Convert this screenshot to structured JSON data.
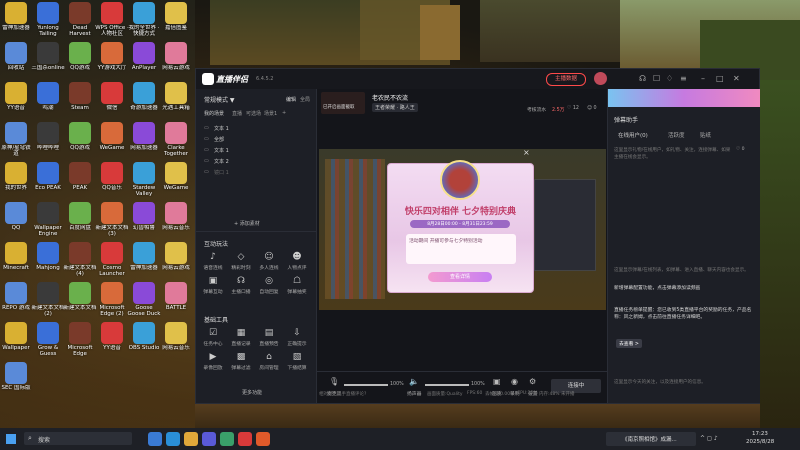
{
  "desktop": {
    "icons": [
      {
        "label": "雷神加速器"
      },
      {
        "label": "Yunlong Tailing"
      },
      {
        "label": "Dead Harvest"
      },
      {
        "label": "WPS Office · 人物社区"
      },
      {
        "label": "我的全世界 · 快捷方式"
      },
      {
        "label": "嘉倍图鉴"
      },
      {
        "label": "回收站"
      },
      {
        "label": "三国杀online"
      },
      {
        "label": "QQ游戏"
      },
      {
        "label": "YY游戏大厅"
      },
      {
        "label": "AnPlayer"
      },
      {
        "label": "网易云游戏"
      },
      {
        "label": "YY语音"
      },
      {
        "label": "鸣潮"
      },
      {
        "label": "Steam"
      },
      {
        "label": "微信"
      },
      {
        "label": "奇游加速器"
      },
      {
        "label": "光遇工具箱"
      },
      {
        "label": "原神/星穹铁道"
      },
      {
        "label": "哔哩哔哩"
      },
      {
        "label": "QQ游戏"
      },
      {
        "label": "WeGame"
      },
      {
        "label": "网易加速器"
      },
      {
        "label": "Clarke Together"
      },
      {
        "label": "我的世界"
      },
      {
        "label": "Eco PEAK"
      },
      {
        "label": "PEAK"
      },
      {
        "label": "QQ音乐"
      },
      {
        "label": "Stardew Valley"
      },
      {
        "label": "WeGame"
      },
      {
        "label": "QQ"
      },
      {
        "label": "Wallpaper Engine"
      },
      {
        "label": "百度网盘"
      },
      {
        "label": "新建文本文档 (3)"
      },
      {
        "label": "幻兽帕鲁"
      },
      {
        "label": "网易云音乐"
      },
      {
        "label": "Minecraft"
      },
      {
        "label": "Mahjong"
      },
      {
        "label": "新建文本文档 (4)"
      },
      {
        "label": "Cosmo Launcher"
      },
      {
        "label": "雷神加速器"
      },
      {
        "label": "网易云游戏"
      },
      {
        "label": "REPO 游戏"
      },
      {
        "label": "新建文本文档 (2)"
      },
      {
        "label": "新建文本文档"
      },
      {
        "label": "Microsoft Edge (2)"
      },
      {
        "label": "Goose Goose Duck"
      },
      {
        "label": "BATTLE"
      },
      {
        "label": "Wallpaper"
      },
      {
        "label": "Grow & Guess"
      },
      {
        "label": "Microsoft Edge"
      },
      {
        "label": "YY语音"
      },
      {
        "label": "OBS Studio"
      },
      {
        "label": "网易云音乐"
      },
      {
        "label": "SEC 国际版"
      }
    ]
  },
  "app": {
    "title": "直播伴侣",
    "version": "6.4.5.2",
    "header_buttons": {
      "live_data": "主播数据",
      "open_stream": "开播指南",
      "share": "分享"
    },
    "stream": {
      "thumb_label": "已开启画面截取",
      "title": "老农民不农流",
      "tag": "王者荣耀 · 路人王",
      "stats": [
        "考核流水",
        "2.5万"
      ],
      "likes": "12",
      "viewers": "0"
    },
    "left": {
      "mode_label": "常规模式 ▼",
      "mode_tabs": [
        "编辑",
        "全局"
      ],
      "scene_header": "我的场景",
      "scene_tabs": [
        "直播",
        "可选场",
        "场景1",
        "+"
      ],
      "scene_items": [
        "文本 1",
        "全部",
        "文本 1",
        "文本 2",
        "镜口 1"
      ],
      "add_material": "+ 添加素材",
      "interaction_title": "互动玩法",
      "interaction_tools": [
        "语音连线",
        "精彩时刻",
        "多人连线",
        "人物点评",
        "弹幕互动",
        "主播口播",
        "自动回复",
        "弹幕抽奖"
      ],
      "basic_title": "基础工具",
      "basic_tools": [
        "任务中心",
        "直播记录",
        "直播预告",
        "正确提示",
        "录像回放",
        "弹幕过滤",
        "房间管理",
        "下播结算"
      ],
      "more": "更多功能"
    },
    "preview": {
      "banner_title": "七夕特典",
      "banner_sub": "快乐四对相伴 七夕特别庆典",
      "date_text": "8月28日00:00 - 8月31日23:59",
      "blurb": "活动期间 开播可参与七夕特别活动",
      "cta": "查看详情"
    },
    "bottom": {
      "mic_label": "麦克风",
      "mic_value": "100%",
      "speaker_label": "扬声器",
      "speaker_value": "100%",
      "tools": [
        "画质",
        "录制",
        "设置"
      ],
      "stream_button": "连接中",
      "status_bar": [
        "相对领主上手直播评论?",
        "画面质量:Quality",
        "FPS:60",
        "丢帧:0(0.00%)",
        "CPU:22%",
        "内存:48%",
        "未开播"
      ]
    },
    "right": {
      "title": "弹幕助手",
      "tabs": [
        "在线用户(0)",
        "活跃度",
        "贴纸"
      ],
      "hint1": "这里显示礼物/在线用户，如礼物、关注，连接弹幕、如果主播在线会显示。",
      "viewers_pill": "0",
      "hint2": "这里显示弹幕/在线列表，如弹幕、进入直播、聊天内容也会显示。",
      "notice1": "新增弹幕配置功能，点击弹幕添加读频画",
      "notice2": "直播任务榜单提醒：您已收到5类直播平台的奖励的任务，产品名称：风之新姆，点击前往直播任务详细吧。",
      "notice_link": "去查看 >",
      "hint3": "这里显示今天的关注，以及连接用户的信息。"
    }
  },
  "taskbar": {
    "search_placeholder": "搜索",
    "active_window": "《南京照相馆》成漏...",
    "time": "17:23",
    "date": "2025/8/28"
  },
  "colors": {
    "accent": "#ff4a4a",
    "window_bg": "#1d1f26",
    "panel_dark": "#14151a",
    "taskbar": "#1e2026"
  }
}
